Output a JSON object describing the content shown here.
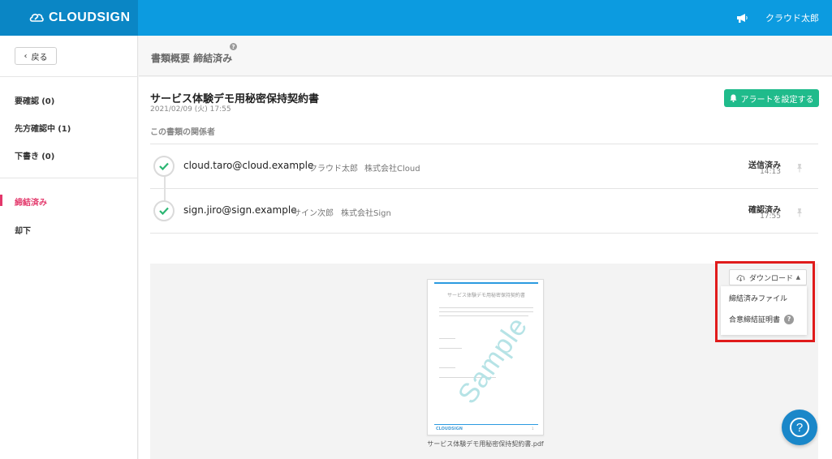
{
  "header": {
    "logo_text": "CLOUDSIGN",
    "user_name": "クラウド太郎",
    "announcement_icon": "megaphone-icon",
    "logo_icon": "cloud-pen-icon"
  },
  "sidebar": {
    "back_label": "戻る",
    "items": [
      {
        "label": "要確認",
        "count": "(0)"
      },
      {
        "label": "先方確認中",
        "count": "(1)"
      },
      {
        "label": "下書き",
        "count": "(0)"
      },
      {
        "label": "締結済み",
        "count": ""
      },
      {
        "label": "却下",
        "count": ""
      }
    ],
    "active_index": 3
  },
  "page": {
    "title": "書類概要 締結済み",
    "help_glyph": "?"
  },
  "document": {
    "title": "サービス体験デモ用秘密保持契約書",
    "date": "2021/02/09 (火) 17:55",
    "alert_button": "アラートを設定する",
    "related_label": "この書類の関係者"
  },
  "parties": [
    {
      "email": "cloud.taro@cloud.example",
      "name": "クラウド太郎",
      "company": "株式会社Cloud",
      "status": "送信済み",
      "time": "14:13"
    },
    {
      "email": "sign.jiro@sign.example",
      "name": "サイン次郎",
      "company": "株式会社Sign",
      "status": "確認済み",
      "time": "17:55"
    }
  ],
  "preview": {
    "thumbnail_title": "サービス体験デモ用秘密保持契約書",
    "watermark": "Sample",
    "footer_logo": "CLOUDSIGN",
    "filename": "サービス体験デモ用秘密保持契約書.pdf"
  },
  "download": {
    "button_label": "ダウンロード",
    "menu_items": [
      {
        "label": "締結済みファイル"
      },
      {
        "label": "合意締結証明書"
      }
    ],
    "help_glyph": "?"
  },
  "help_fab": {
    "glyph": "?"
  },
  "colors": {
    "header_blue": "#0c9be0",
    "logo_blue": "#0a86c5",
    "alert_green": "#1fbb8b",
    "active_pink": "#e3386b",
    "highlight_red": "#e01b1b",
    "check_green": "#2bb673"
  }
}
